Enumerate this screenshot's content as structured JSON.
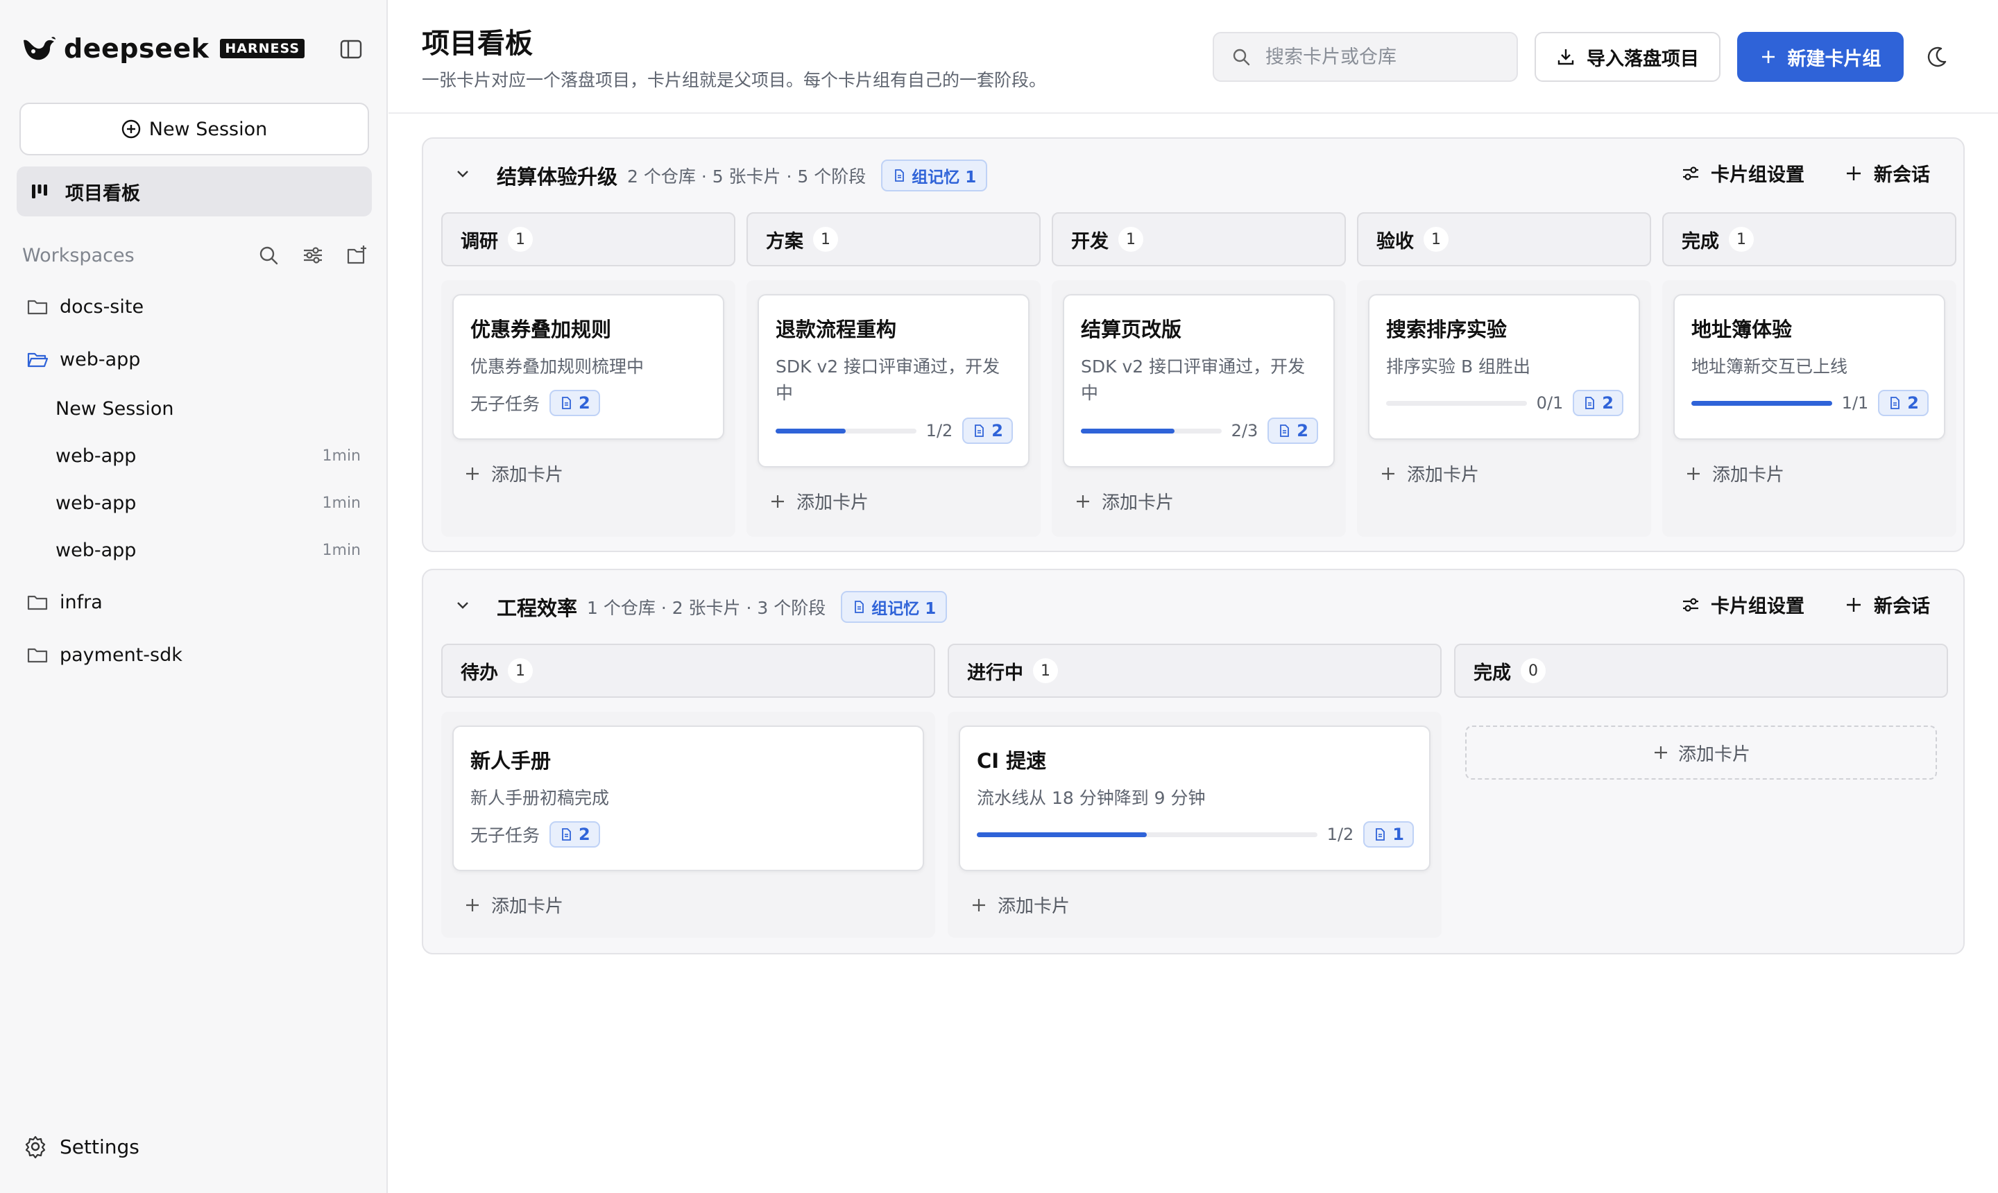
{
  "brand": {
    "name": "deepseek",
    "tag": "HARNESS"
  },
  "sidebar": {
    "new_session": "New Session",
    "nav_board": "项目看板",
    "workspaces_title": "Workspaces",
    "tree": [
      {
        "label": "docs-site"
      },
      {
        "label": "web-app"
      },
      {
        "label": "infra"
      },
      {
        "label": "payment-sdk"
      }
    ],
    "sessions": [
      {
        "label": "New Session",
        "time": ""
      },
      {
        "label": "web-app",
        "time": "1min"
      },
      {
        "label": "web-app",
        "time": "1min"
      },
      {
        "label": "web-app",
        "time": "1min"
      }
    ],
    "settings": "Settings"
  },
  "header": {
    "title": "项目看板",
    "subtitle": "一张卡片对应一个落盘项目，卡片组就是父项目。每个卡片组有自己的一套阶段。",
    "search_placeholder": "搜索卡片或仓库",
    "import_label": "导入落盘项目",
    "new_group_label": "新建卡片组"
  },
  "colors": {
    "accent": "#2f63d8",
    "badge_bg": "#e8effc"
  },
  "groups": [
    {
      "title": "结算体验升级",
      "meta": "2 个仓库 · 5 张卡片 · 5 个阶段",
      "memo": "组记忆 1",
      "settings_label": "卡片组设置",
      "new_chat_label": "新会话",
      "columns": [
        {
          "name": "调研",
          "count": "1",
          "cards": [
            {
              "title": "优惠券叠加规则",
              "desc": "优惠券叠加规则梳理中",
              "no_task": "无子任务",
              "docs": "2"
            }
          ],
          "add": "添加卡片"
        },
        {
          "name": "方案",
          "count": "1",
          "cards": [
            {
              "title": "退款流程重构",
              "desc": "SDK v2 接口评审通过，开发中",
              "progress": 0.5,
              "frac": "1/2",
              "docs": "2"
            }
          ],
          "add": "添加卡片"
        },
        {
          "name": "开发",
          "count": "1",
          "cards": [
            {
              "title": "结算页改版",
              "desc": "SDK v2 接口评审通过，开发中",
              "progress": 0.667,
              "frac": "2/3",
              "docs": "2"
            }
          ],
          "add": "添加卡片"
        },
        {
          "name": "验收",
          "count": "1",
          "cards": [
            {
              "title": "搜索排序实验",
              "desc": "排序实验 B 组胜出",
              "progress": 0,
              "frac": "0/1",
              "docs": "2"
            }
          ],
          "add": "添加卡片"
        },
        {
          "name": "完成",
          "count": "1",
          "cards": [
            {
              "title": "地址簿体验",
              "desc": "地址簿新交互已上线",
              "progress": 1,
              "frac": "1/1",
              "docs": "2"
            }
          ],
          "add": "添加卡片"
        }
      ]
    },
    {
      "title": "工程效率",
      "meta": "1 个仓库 · 2 张卡片 · 3 个阶段",
      "memo": "组记忆 1",
      "settings_label": "卡片组设置",
      "new_chat_label": "新会话",
      "columns": [
        {
          "name": "待办",
          "count": "1",
          "cards": [
            {
              "title": "新人手册",
              "desc": "新人手册初稿完成",
              "no_task": "无子任务",
              "docs": "2"
            }
          ],
          "add": "添加卡片"
        },
        {
          "name": "进行中",
          "count": "1",
          "cards": [
            {
              "title": "CI 提速",
              "desc": "流水线从 18 分钟降到 9 分钟",
              "progress": 0.5,
              "frac": "1/2",
              "docs": "1"
            }
          ],
          "add": "添加卡片"
        },
        {
          "name": "完成",
          "count": "0",
          "cards": [],
          "add": "添加卡片"
        }
      ]
    }
  ]
}
